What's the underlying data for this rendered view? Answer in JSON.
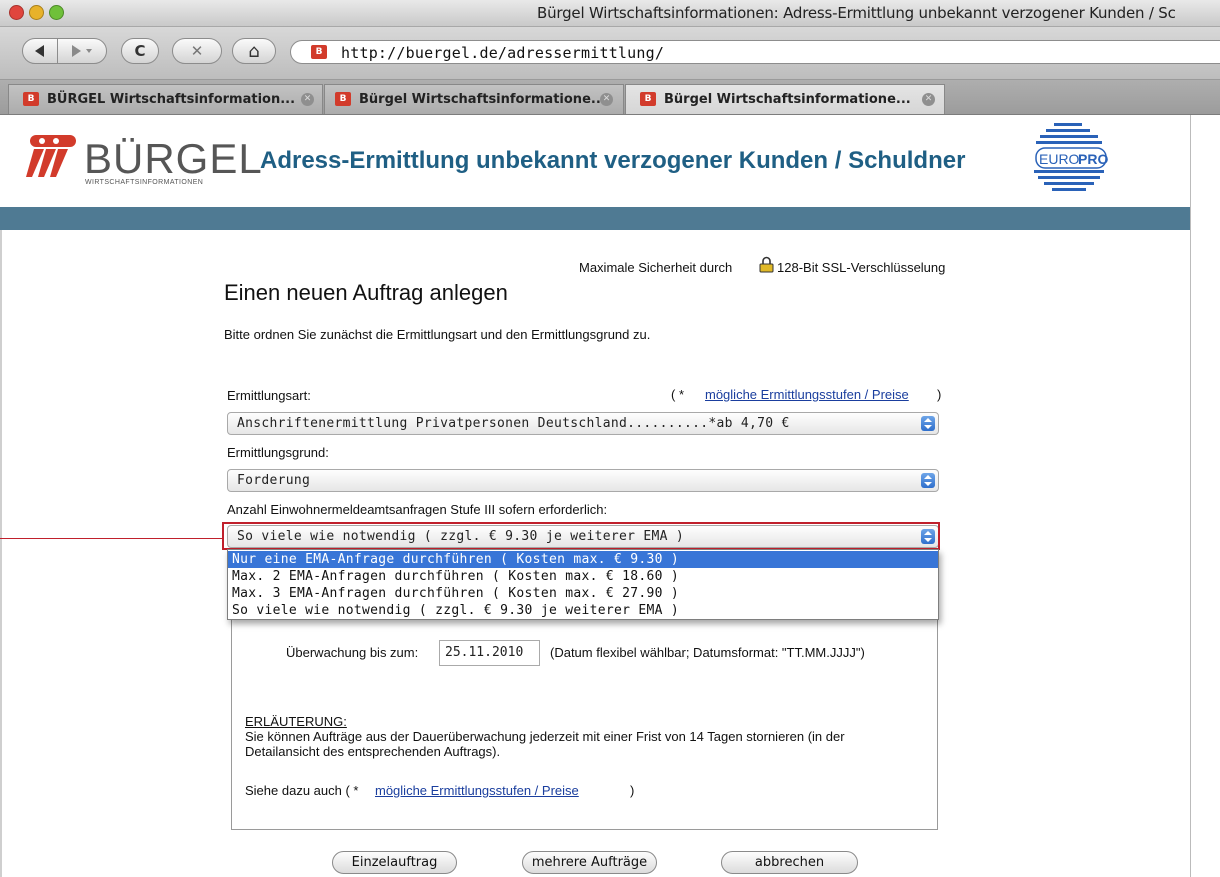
{
  "window": {
    "title": "Bürgel Wirtschaftsinformationen: Adress-Ermittlung unbekannt verzogener Kunden / Sc"
  },
  "toolbar": {
    "back_icon": "back-arrow-icon",
    "forward_icon": "forward-arrow-icon",
    "reload_symbol": "C",
    "stop_symbol": "✕",
    "home_symbol": "⌂",
    "url": "http://buergel.de/adressermittlung/"
  },
  "tabs": [
    {
      "label": "BÜRGEL Wirtschaftsinformation..."
    },
    {
      "label": "Bürgel Wirtschaftsinformatione..."
    },
    {
      "label": "Bürgel Wirtschaftsinformatione..."
    }
  ],
  "header": {
    "brand": "BÜRGEL",
    "brand_sub": "WIRTSCHAFTSINFORMATIONEN",
    "title": "Adress-Ermittlung unbekannt verzogener Kunden / Schuldner",
    "partner_logo": {
      "prefix": "EURO",
      "suffix": "PRO"
    },
    "colors": {
      "title": "#1f5f84",
      "bar": "#4f7a93",
      "brand_red": "#d23b2b"
    }
  },
  "form": {
    "security_prefix": "Maximale Sicherheit durch",
    "security_suffix": "128-Bit SSL-Verschlüsselung",
    "heading": "Einen neuen Auftrag anlegen",
    "intro": "Bitte ordnen Sie zunächst die Ermittlungsart und den Ermittlungsgrund zu.",
    "ermittlungsart_label": "Ermittlungsart:",
    "prices_link_prefix": "( *",
    "prices_link": "mögliche Ermittlungsstufen / Preise",
    "prices_link_suffix": ")",
    "ermittlungsart_value": "Anschriftenermittlung Privatpersonen Deutschland..........*ab 4,70 €",
    "ermittlungsgrund_label": "Ermittlungsgrund:",
    "ermittlungsgrund_value": "Forderung",
    "ema_label": "Anzahl Einwohnermeldeamtsanfragen Stufe III sofern erforderlich:",
    "ema_value": "So viele wie notwendig ( zzgl. € 9.30 je weiterer EMA )",
    "ema_options": [
      "Nur eine EMA-Anfrage durchführen ( Kosten max. € 9.30 )",
      "Max. 2 EMA-Anfragen durchführen ( Kosten max. € 18.60 )",
      "Max. 3 EMA-Anfragen durchführen ( Kosten max. € 27.90 )",
      "So viele wie notwendig ( zzgl. € 9.30 je weiterer EMA )"
    ],
    "ema_highlighted_index": 0,
    "monitoring_label": "Überwachung bis zum:",
    "monitoring_date": "25.11.2010",
    "monitoring_hint": "(Datum flexibel wählbar; Datumsformat: \"TT.MM.JJJJ\")",
    "explanation_heading": "ERLÄUTERUNG:",
    "explanation_line1": "Sie können Aufträge aus der Dauerüberwachung jederzeit mit einer Frist von 14 Tagen stornieren (in der",
    "explanation_line2": "Detailansicht des entsprechenden Auftrags).",
    "see_also_prefix": "Siehe dazu auch ( *",
    "see_also_link": "mögliche Ermittlungsstufen / Preise",
    "see_also_suffix": ")"
  },
  "buttons": {
    "single": "Einzelauftrag",
    "multiple": "mehrere Aufträge",
    "cancel": "abbrechen"
  }
}
